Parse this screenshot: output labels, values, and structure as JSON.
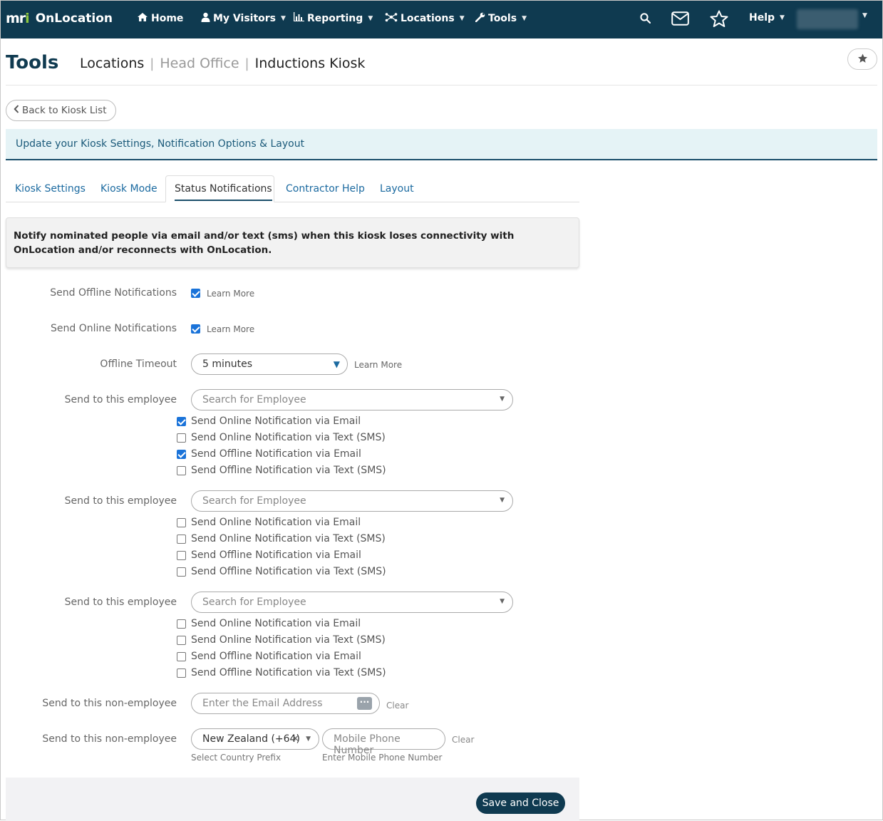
{
  "nav": {
    "logo": "mri",
    "app_name": "OnLocation",
    "home": "Home",
    "my_visitors": "My Visitors",
    "reporting": "Reporting",
    "locations": "Locations",
    "tools": "Tools",
    "help": "Help",
    "user": ""
  },
  "header": {
    "title": "Tools",
    "breadcrumb": [
      "Locations",
      "Head Office",
      "Inductions Kiosk"
    ]
  },
  "back_button": "Back to Kiosk List",
  "info_bar": "Update your Kiosk Settings, Notification Options & Layout",
  "tabs": [
    "Kiosk Settings",
    "Kiosk Mode",
    "Status Notifications",
    "Contractor Help",
    "Layout"
  ],
  "active_tab": "Status Notifications",
  "notice": "Notify nominated people via email and/or text (sms) when this kiosk loses connectivity with OnLocation and/or reconnects with OnLocation.",
  "form": {
    "offline_label": "Send Offline Notifications",
    "offline_checked": true,
    "online_label": "Send Online Notifications",
    "online_checked": true,
    "learn_more": "Learn More",
    "timeout_label": "Offline Timeout",
    "timeout_value": "5 minutes",
    "employee_label": "Send to this employee",
    "employee_placeholder": "Search for Employee",
    "options": [
      "Send Online Notification via Email",
      "Send Online Notification via Text (SMS)",
      "Send Offline Notification via Email",
      "Send Offline Notification via Text (SMS)"
    ],
    "employees": [
      {
        "checks": [
          true,
          false,
          true,
          false
        ]
      },
      {
        "checks": [
          false,
          false,
          false,
          false
        ]
      },
      {
        "checks": [
          false,
          false,
          false,
          false
        ]
      }
    ],
    "non_employee_label": "Send to this non-employee",
    "email_placeholder": "Enter the Email Address",
    "clear": "Clear",
    "country_value": "New Zealand (+64)",
    "phone_placeholder": "Mobile Phone Number",
    "country_hint": "Select Country Prefix",
    "phone_hint": "Enter Mobile Phone Number"
  },
  "save_button": "Save and Close"
}
